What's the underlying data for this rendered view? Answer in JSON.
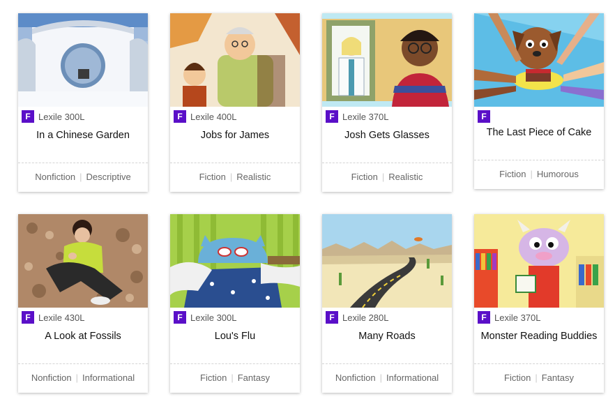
{
  "badge_letter": "F",
  "brand_color": "#5a0fc8",
  "books": [
    {
      "level": "Lexile 300L",
      "title": "In a Chinese Garden",
      "genre": "Nonfiction",
      "subgenre": "Descriptive",
      "illustration": "snowy-moon-gate-garden"
    },
    {
      "level": "Lexile 400L",
      "title": "Jobs for James",
      "genre": "Fiction",
      "subgenre": "Realistic",
      "illustration": "grandpa-and-boy"
    },
    {
      "level": "Lexile 370L",
      "title": "Josh Gets Glasses",
      "genre": "Fiction",
      "subgenre": "Realistic",
      "illustration": "boy-with-glasses-and-doctor"
    },
    {
      "level": "",
      "title": "The Last Piece of Cake",
      "genre": "Fiction",
      "subgenre": "Humorous",
      "illustration": "dog-and-cake"
    },
    {
      "level": "Lexile 430L",
      "title": "A Look at Fossils",
      "genre": "Nonfiction",
      "subgenre": "Informational",
      "illustration": "girl-in-leaves"
    },
    {
      "level": "Lexile 300L",
      "title": "Lou's Flu",
      "genre": "Fiction",
      "subgenre": "Fantasy",
      "illustration": "sick-monster-in-bed"
    },
    {
      "level": "Lexile 280L",
      "title": "Many Roads",
      "genre": "Nonfiction",
      "subgenre": "Informational",
      "illustration": "desert-road"
    },
    {
      "level": "Lexile 370L",
      "title": "Monster Reading Buddies",
      "genre": "Fiction",
      "subgenre": "Fantasy",
      "illustration": "monster-with-book"
    }
  ]
}
